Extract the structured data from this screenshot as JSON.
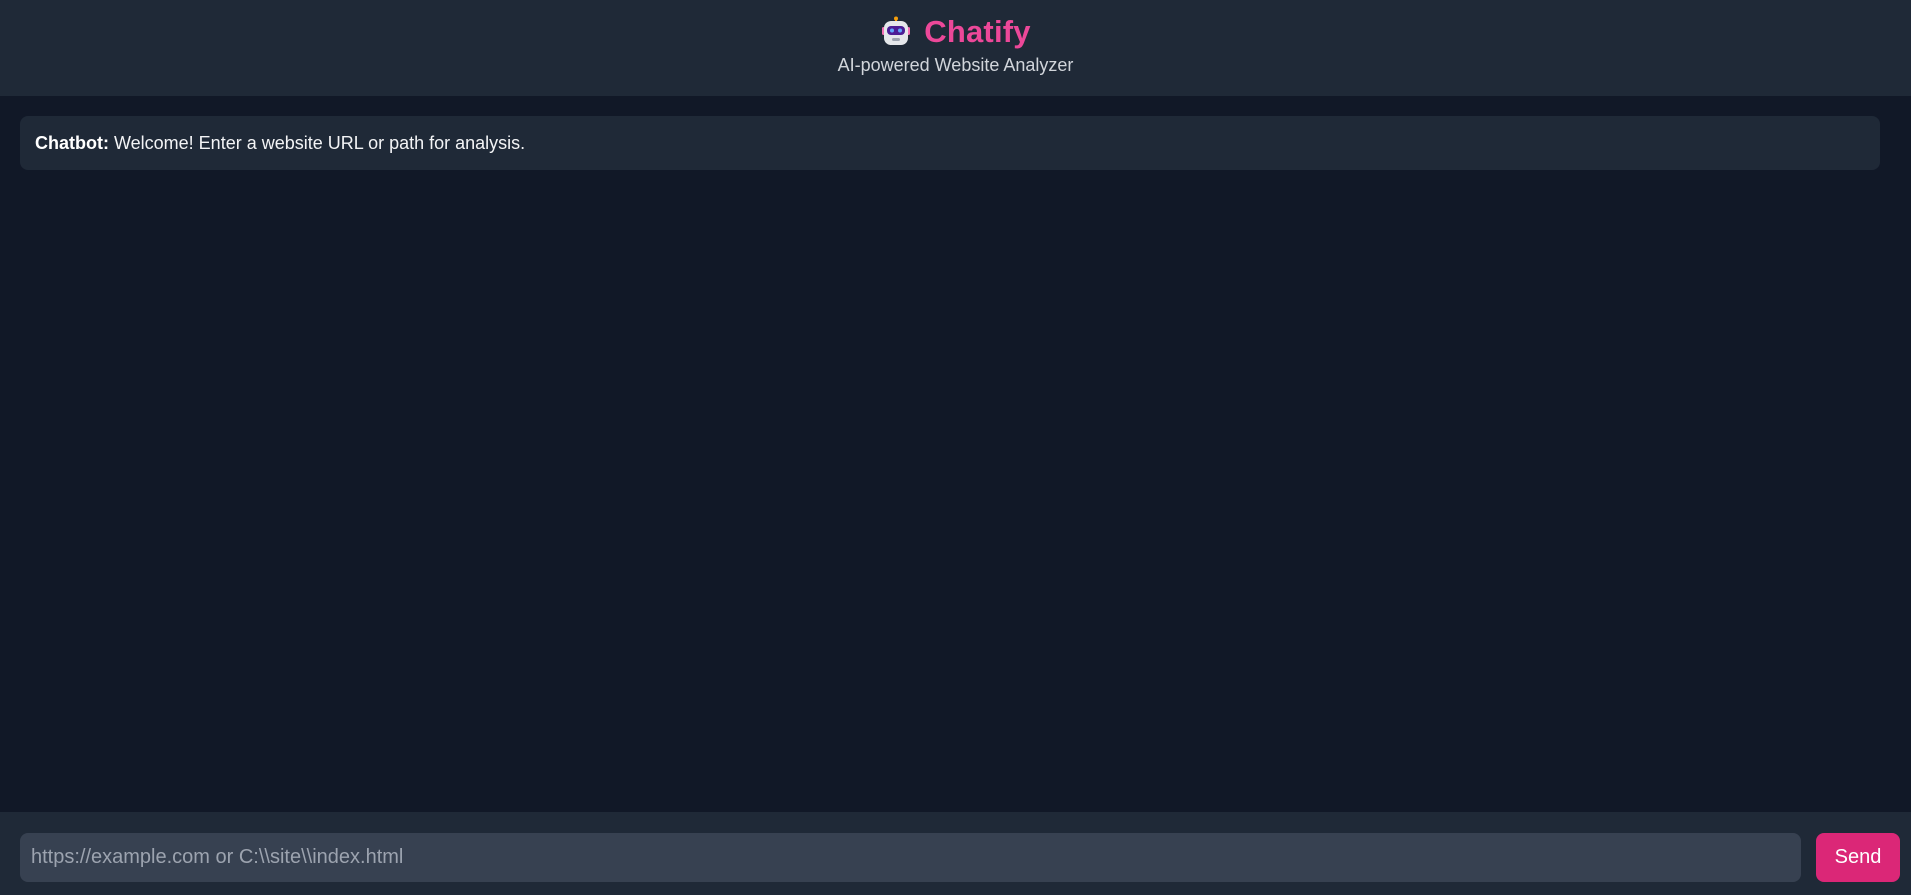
{
  "header": {
    "icon": "robot-icon",
    "title": "Chatify",
    "subtitle": "AI-powered Website Analyzer"
  },
  "chat": {
    "messages": [
      {
        "sender": "Chatbot:",
        "text": "Welcome! Enter a website URL or path for analysis."
      }
    ]
  },
  "composer": {
    "value": "",
    "placeholder": "https://example.com or C:\\\\site\\\\index.html",
    "send_label": "Send"
  },
  "colors": {
    "background": "#111827",
    "panel": "#1f2937",
    "input": "#374151",
    "accent": "#ec4899",
    "button": "#db2777"
  }
}
